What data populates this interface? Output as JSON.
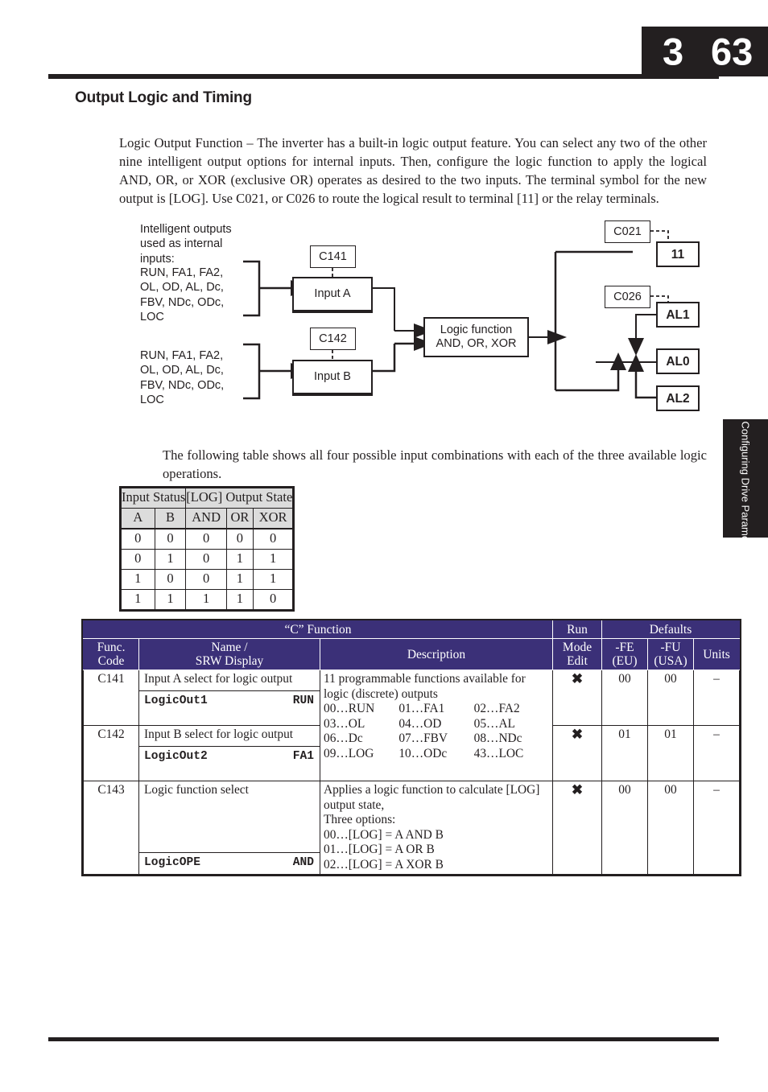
{
  "page": {
    "chapter": "3",
    "folio": "63",
    "side_tab": "Configuring Drive Parameters"
  },
  "section": {
    "title": "Output Logic and Timing",
    "intro_paragraph": "Logic Output Function – The inverter has a built-in logic output feature. You can select any two of the other nine intelligent output options for internal inputs. Then, configure the logic function to apply the logical AND, OR, or XOR (exclusive OR) operates as desired to the two inputs. The terminal symbol for the new output is [LOG]. Use C021, or C026 to route the logical result to terminal [11] or the relay terminals.",
    "table_intro_paragraph": "The following table shows all four possible input combinations with each of the three available logic operations."
  },
  "diagram": {
    "caption": "Intelligent outputs\nused as internal\ninputs:",
    "input_list_a": "RUN, FA1, FA2,\nOL, OD, AL, Dc,\nFBV, NDc, ODc,\nLOC",
    "input_list_b": "RUN, FA1, FA2,\nOL, OD, AL, Dc,\nFBV, NDc, ODc,\nLOC",
    "param_c141": "C141",
    "param_c142": "C142",
    "box_input_a": "Input A",
    "box_input_b": "Input B",
    "box_logic_function": "Logic function\nAND, OR, XOR",
    "param_c021": "C021",
    "param_c026": "C026",
    "terminal_11": "11",
    "terminal_al1": "AL1",
    "terminal_al0": "AL0",
    "terminal_al2": "AL2"
  },
  "truth_table": {
    "group_headers": [
      "Input Status",
      "[LOG] Output State"
    ],
    "columns": [
      "A",
      "B",
      "AND",
      "OR",
      "XOR"
    ],
    "rows": [
      [
        "0",
        "0",
        "0",
        "0",
        "0"
      ],
      [
        "0",
        "1",
        "0",
        "1",
        "1"
      ],
      [
        "1",
        "0",
        "0",
        "1",
        "1"
      ],
      [
        "1",
        "1",
        "1",
        "1",
        "0"
      ]
    ]
  },
  "param_table": {
    "group_c_function": "“C” Function",
    "group_run": "Run",
    "group_defaults": "Defaults",
    "col_func_code": "Func.\nCode",
    "col_name_srw": "Name /\nSRW Display",
    "col_description": "Description",
    "col_mode_edit": "Mode\nEdit",
    "col_fe": "-FE\n(EU)",
    "col_fu": "-FU\n(USA)",
    "col_units": "Units",
    "header_accent": "#3b3078",
    "rows": [
      {
        "code": "C141",
        "name": "Input A select for logic output",
        "srw_label": "LogicOut1",
        "srw_value": "RUN",
        "run_mode_edit": "✖",
        "default_fe": "00",
        "default_fu": "00",
        "units": "–"
      },
      {
        "code": "C142",
        "name": "Input B select for logic output",
        "srw_label": "LogicOut2",
        "srw_value": "FA1",
        "run_mode_edit": "✖",
        "default_fe": "01",
        "default_fu": "01",
        "units": "–"
      },
      {
        "code": "C143",
        "name": "Logic function select",
        "srw_label": "LogicOPE",
        "srw_value": "AND",
        "run_mode_edit": "✖",
        "default_fe": "00",
        "default_fu": "00",
        "units": "–"
      }
    ],
    "description_c141_c142": {
      "intro": "11 programmable functions available for logic (discrete) outputs",
      "options": [
        "00…RUN",
        "01…FA1",
        "02…FA2",
        "03…OL",
        "04…OD",
        "05…AL",
        "06…Dc",
        "07…FBV",
        "08…NDc",
        "09…LOG",
        "10…ODc",
        "43…LOC"
      ]
    },
    "description_c143": {
      "line1": "Applies a logic function to calculate [LOG] output state,",
      "line2": "Three options:",
      "options": [
        "00…[LOG] = A AND B",
        "01…[LOG] = A OR B",
        "02…[LOG] = A XOR B"
      ]
    }
  }
}
